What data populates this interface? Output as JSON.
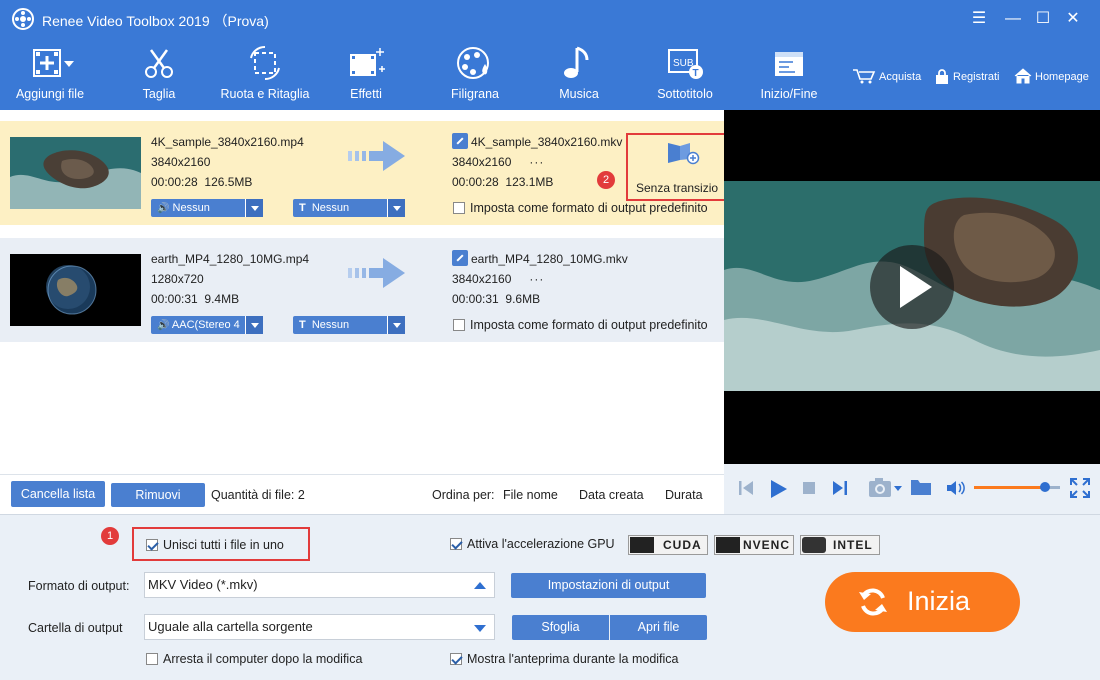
{
  "titlebar": {
    "title": "Renee Video Toolbox 2019 （Prova)",
    "menu_glyph": "☰",
    "minimize_glyph": "—",
    "maximize_glyph": "☐",
    "close_glyph": "✕"
  },
  "toolbar": {
    "tools": [
      {
        "label": "Aggiungi file",
        "icon": "add-file-icon"
      },
      {
        "label": "Taglia",
        "icon": "scissors-icon"
      },
      {
        "label": "Ruota e Ritaglia",
        "icon": "crop-rotate-icon"
      },
      {
        "label": "Effetti",
        "icon": "effects-icon"
      },
      {
        "label": "Filigrana",
        "icon": "watermark-icon"
      },
      {
        "label": "Musica",
        "icon": "music-icon"
      },
      {
        "label": "Sottotitolo",
        "icon": "subtitle-icon"
      },
      {
        "label": "Inizio/Fine",
        "icon": "start-end-icon"
      }
    ],
    "links": {
      "buy": "Acquista",
      "register": "Registrati",
      "home": "Homepage"
    }
  },
  "files": [
    {
      "source_name": "4K_sample_3840x2160.mp4",
      "source_resolution": "3840x2160",
      "source_duration": "00:00:28",
      "source_size": "126.5MB",
      "output_name": "4K_sample_3840x2160.mkv",
      "output_resolution": "3840x2160",
      "output_duration": "00:00:28",
      "output_size": "123.1MB",
      "more": "···",
      "audio": "Nessun",
      "subtitle": "Nessun",
      "default_format_label": "Imposta come formato di output predefinito",
      "transition_label": "Senza transizio"
    },
    {
      "source_name": "earth_MP4_1280_10MG.mp4",
      "source_resolution": "1280x720",
      "source_duration": "00:00:31",
      "source_size": "9.4MB",
      "output_name": "earth_MP4_1280_10MG.mkv",
      "output_resolution": "3840x2160",
      "output_duration": "00:00:31",
      "output_size": "9.6MB",
      "more": "···",
      "audio": "AAC(Stereo 4",
      "subtitle": "Nessun",
      "default_format_label": "Imposta come formato di output predefinito"
    }
  ],
  "annotations": {
    "badge_1": "1",
    "badge_2": "2"
  },
  "listbar": {
    "clear_list": "Cancella lista",
    "remove": "Rimuovi",
    "file_count": "Quantità di file: 2",
    "sort_by": "Ordina per:",
    "sort_name": "File nome",
    "sort_date": "Data creata",
    "sort_duration": "Durata"
  },
  "player": {
    "volume_fraction": 0.82
  },
  "bottom": {
    "merge_label": "Unisci tutti i file in uno",
    "gpu_label": "Attiva l'accelerazione GPU",
    "gpu_badges": [
      "CUDA",
      "NVENC",
      "INTEL"
    ],
    "format_label": "Formato di output:",
    "format_value": "MKV Video (*.mkv)",
    "output_settings": "Impostazioni di output",
    "folder_label": "Cartella di output",
    "folder_value": "Uguale alla cartella sorgente",
    "browse": "Sfoglia",
    "open_file": "Apri file",
    "shutdown_label": "Arresta il computer dopo la modifica",
    "preview_label": "Mostra l'anteprima durante la modifica",
    "start": "Inizia"
  },
  "colors": {
    "accent": "#3a79d6",
    "highlight": "#e23b3b",
    "start": "#fb7a1e",
    "row_selected": "#fdf0c4"
  }
}
